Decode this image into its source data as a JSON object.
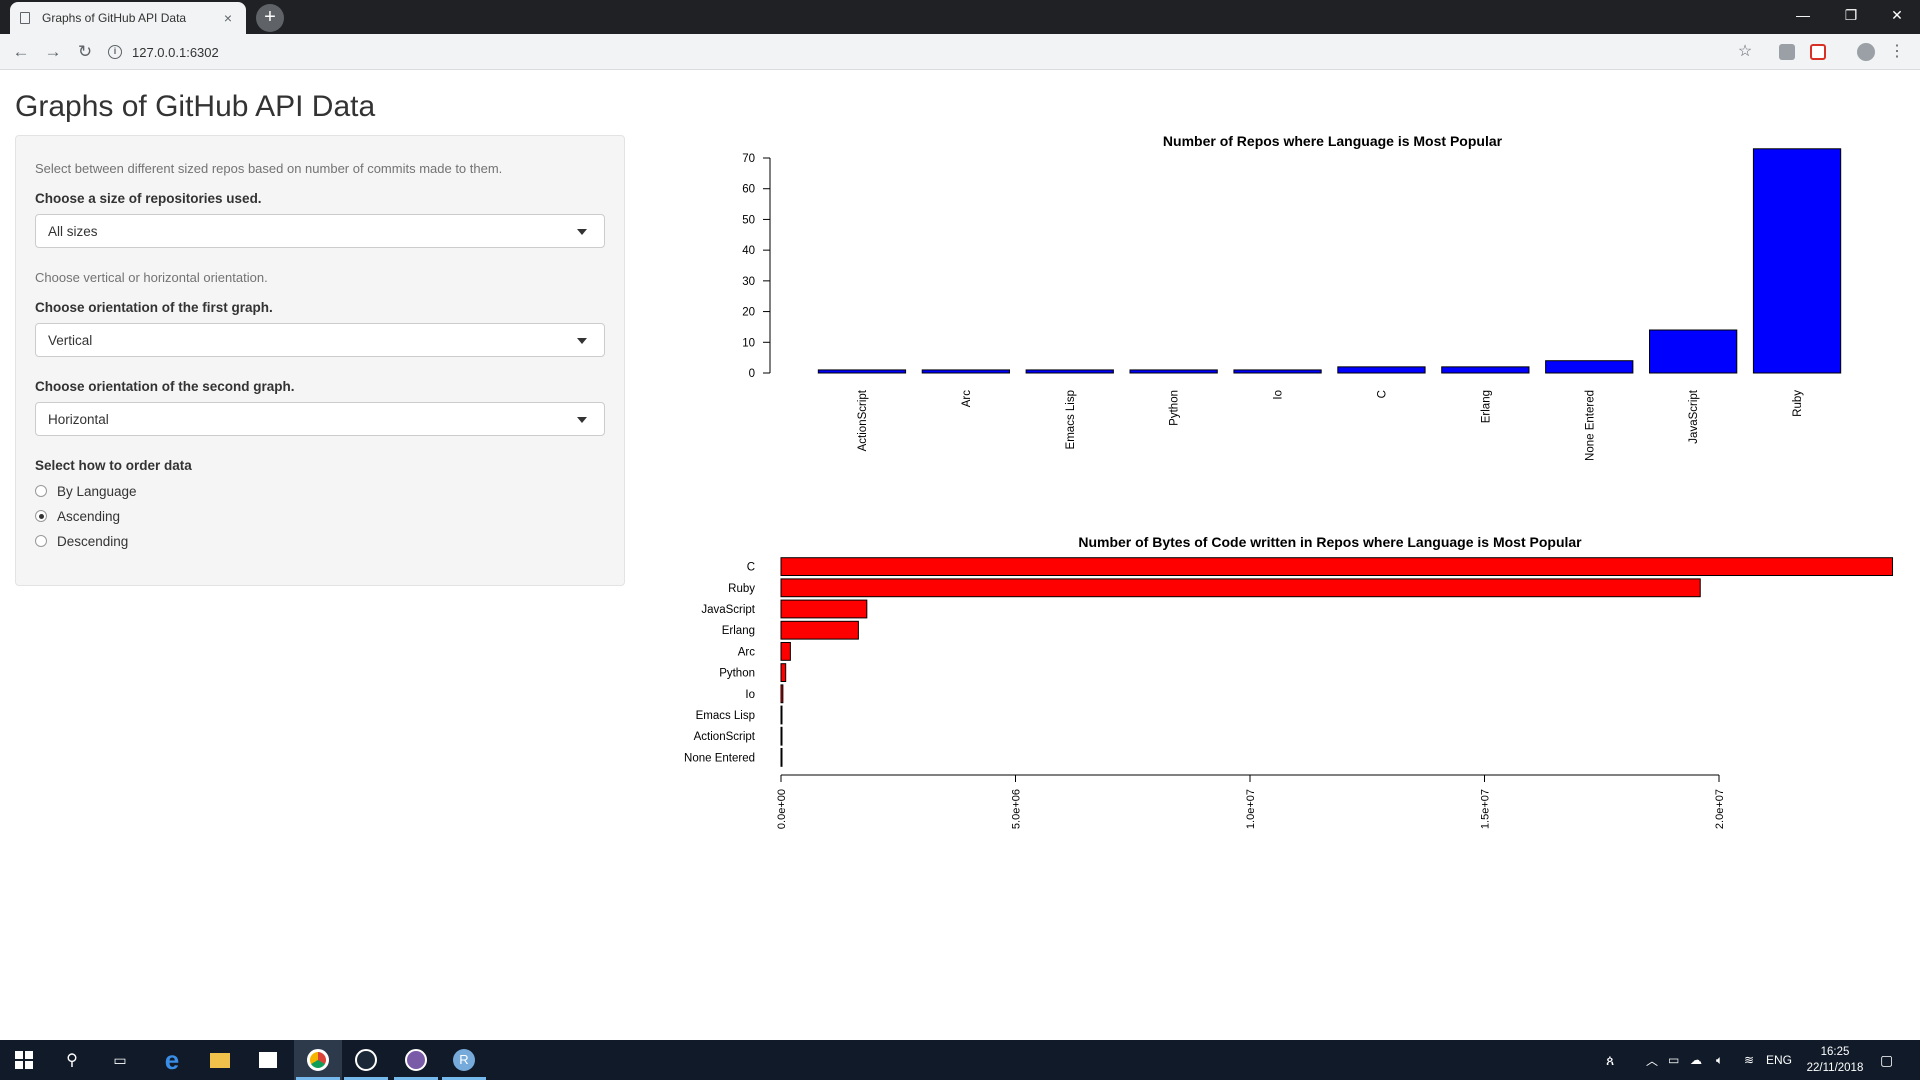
{
  "browser": {
    "tab_title": "Graphs of GitHub API Data",
    "url": "127.0.0.1:6302",
    "new_tab": "+",
    "tab_close": "×",
    "win_min": "—",
    "win_restore": "❐",
    "win_close": "✕"
  },
  "app": {
    "title": "Graphs of GitHub API Data",
    "size_help": "Select between different sized repos based on number of commits made to them.",
    "size_label": "Choose a size of repositories used.",
    "size_value": "All sizes",
    "orient_help": "Choose vertical or horizontal orientation.",
    "orient1_label": "Choose orientation of the first graph.",
    "orient1_value": "Vertical",
    "orient2_label": "Choose orientation of the second graph.",
    "orient2_value": "Horizontal",
    "order_label": "Select how to order data",
    "order_options": [
      "By Language",
      "Ascending",
      "Descending"
    ],
    "order_selected": "Ascending"
  },
  "chart_data": [
    {
      "type": "bar",
      "orientation": "vertical",
      "title": "Number of Repos where Language is Most Popular",
      "categories": [
        "ActionScript",
        "Arc",
        "Emacs Lisp",
        "Python",
        "Io",
        "C",
        "Erlang",
        "None Entered",
        "JavaScript",
        "Ruby"
      ],
      "values": [
        1,
        1,
        1,
        1,
        1,
        2,
        2,
        4,
        14,
        73
      ],
      "yticks": [
        0,
        10,
        20,
        30,
        40,
        50,
        60,
        70
      ],
      "ylim": [
        0,
        70
      ],
      "color": "#0000ff"
    },
    {
      "type": "bar",
      "orientation": "horizontal",
      "title": "Number of Bytes of Code written in Repos where Language is Most Popular",
      "categories": [
        "None Entered",
        "ActionScript",
        "Emacs Lisp",
        "Io",
        "Python",
        "Arc",
        "Erlang",
        "JavaScript",
        "Ruby",
        "C"
      ],
      "values": [
        5000,
        10000,
        15000,
        40000,
        100000,
        200000,
        1650000,
        1830000,
        19600000,
        23700000
      ],
      "xticks": [
        0,
        5000000,
        10000000,
        15000000,
        20000000
      ],
      "xtick_labels": [
        "0.0e+00",
        "5.0e+06",
        "1.0e+07",
        "1.5e+07",
        "2.0e+07"
      ],
      "color": "#ff0000"
    }
  ],
  "taskbar": {
    "lang": "ENG",
    "time": "16:25",
    "date": "22/11/2018"
  }
}
